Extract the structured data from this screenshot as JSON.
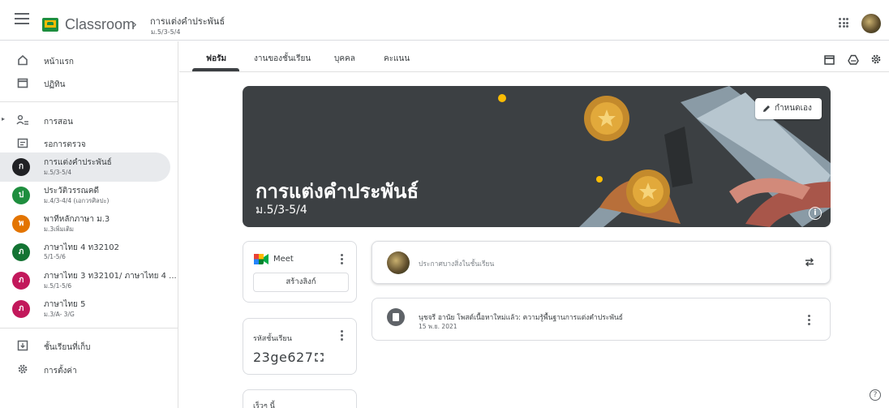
{
  "header": {
    "brand": "Classroom",
    "breadcrumb_separator": "›",
    "class_title": "การแต่งคำประพันธ์",
    "class_section": "ม.5/3-5/4"
  },
  "sidebar": {
    "home_label": "หน้าแรก",
    "calendar_label": "ปฏิทิน",
    "teaching_label": "การสอน",
    "to_review_label": "รอการตรวจ",
    "classes": [
      {
        "initial": "ก",
        "name": "การแต่งคำประพันธ์",
        "section": "ม.5/3-5/4",
        "color": "#202124"
      },
      {
        "initial": "ป",
        "name": "ประวัติวรรณคดี",
        "section": "ม.4/3-4/4 (เอกวรศิลปะ)",
        "color": "#1e8e3e"
      },
      {
        "initial": "พ",
        "name": "พาทีหลักภาษา ม.3",
        "section": "ม.3เพิ่มเติม",
        "color": "#e37400"
      },
      {
        "initial": "ภ",
        "name": "ภาษาไทย 4 ท32102",
        "section": "5/1-5/6",
        "color": "#137333"
      },
      {
        "initial": "ภ",
        "name": "ภาษาไทย 3 ท32101/ ภาษาไทย 4 ...",
        "section": "ม.5/1-5/6",
        "color": "#c2185b"
      },
      {
        "initial": "ภ",
        "name": "ภาษาไทย 5",
        "section": "ม.3/A- 3/G",
        "color": "#c2185b"
      }
    ],
    "archived_label": "ชั้นเรียนที่เก็บ",
    "settings_label": "การตั้งค่า"
  },
  "tabs": [
    "ฟอรัม",
    "งานของชั้นเรียน",
    "บุคคล",
    "คะแนน"
  ],
  "banner": {
    "title": "การแต่งคำประพันธ์",
    "subtitle": "ม.5/3-5/4",
    "customize_label": "กำหนดเอง"
  },
  "meet_card": {
    "label": "Meet",
    "button_label": "สร้างลิงก์"
  },
  "code_card": {
    "label": "รหัสชั้นเรียน",
    "value": "23ge627"
  },
  "upcoming_card": {
    "label": "เร็วๆ นี้"
  },
  "announce": {
    "placeholder": "ประกาศบางสิ่งในชั้นเรียน"
  },
  "post": {
    "title": "นุชจรี อานัย โพสต์เนื้อหาใหม่แล้ว: ความรู้พื้นฐานการแต่งคำประพันธ์",
    "date": "15 พ.ย. 2021"
  },
  "help": {
    "glyph": "?"
  }
}
